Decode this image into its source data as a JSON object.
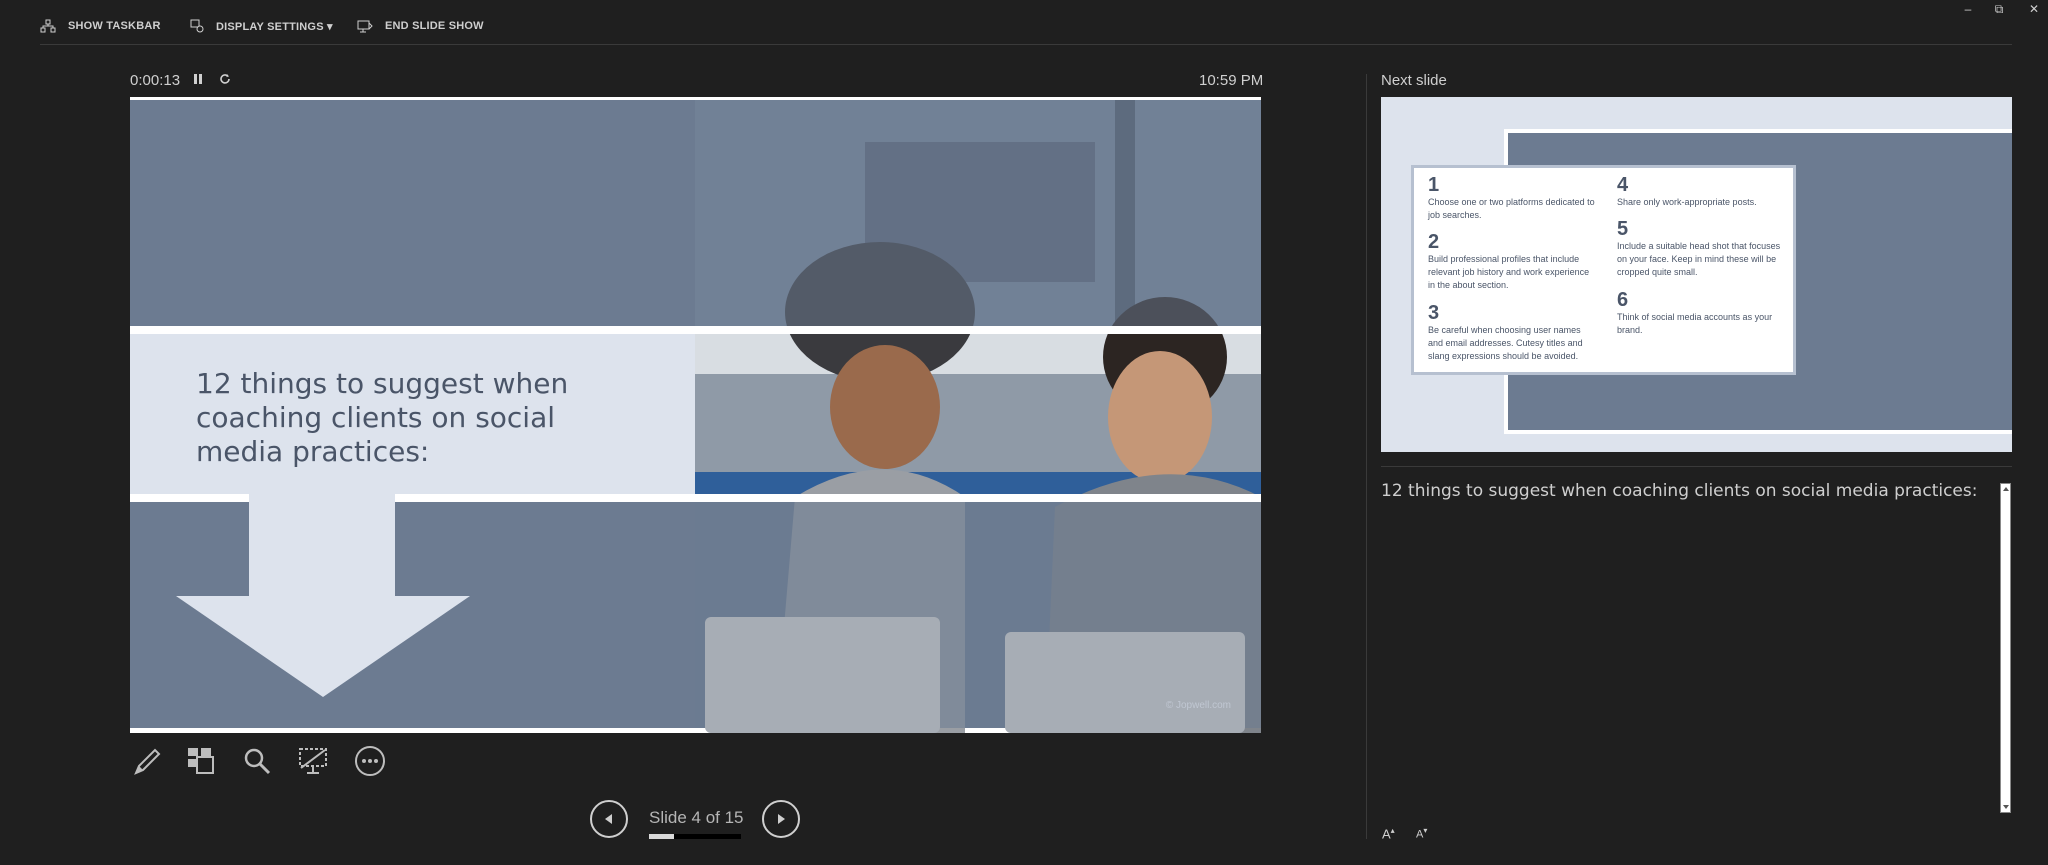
{
  "toolbar": {
    "show_taskbar": "SHOW TASKBAR",
    "display_settings": "DISPLAY SETTINGS ▾",
    "end_slide_show": "END SLIDE SHOW"
  },
  "window": {
    "minimize": "–",
    "restore": "⧉",
    "close": "✕"
  },
  "presenter": {
    "elapsed_time": "0:00:13",
    "clock": "10:59 PM",
    "pause_icon": "pause-icon",
    "reset_icon": "reset-icon"
  },
  "current_slide": {
    "title": "12 things to suggest when coaching clients on social media practices:",
    "credit": "© Jopwell.com"
  },
  "navigation": {
    "counter": "Slide 4 of 15",
    "current": 4,
    "total": 15,
    "progress_fraction": 0.27
  },
  "next_slide": {
    "label": "Next slide",
    "tips": [
      {
        "num": "1",
        "text": "Choose one or two platforms dedicated to job searches."
      },
      {
        "num": "2",
        "text": "Build professional profiles that include relevant job history and work experience in the about section."
      },
      {
        "num": "3",
        "text": "Be careful when choosing user names and email addresses. Cutesy titles and slang expressions should be avoided."
      },
      {
        "num": "4",
        "text": "Share only work-appropriate posts."
      },
      {
        "num": "5",
        "text": "Include a suitable head shot that focuses on your face. Keep in mind these will be cropped quite small."
      },
      {
        "num": "6",
        "text": "Think of social media accounts as your brand."
      }
    ]
  },
  "notes": {
    "text": "12 things to suggest when coaching clients on social media practices:",
    "increase_font": "A",
    "decrease_font": "A"
  },
  "colors": {
    "background": "#1f1f1f",
    "slide_band": "#6c7b91",
    "slide_light": "#dde3ed",
    "title_text": "#4a5568"
  }
}
